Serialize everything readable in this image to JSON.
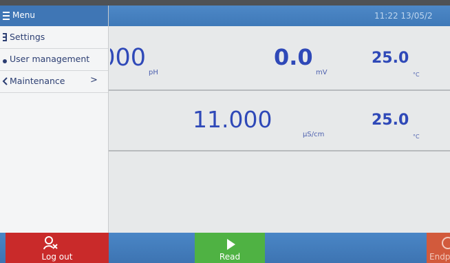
{
  "header": {
    "time": "11:22  13/05/2"
  },
  "menu": {
    "title": "Menu",
    "items": [
      {
        "label": "Settings",
        "icon": "gear-icon"
      },
      {
        "label": "User management",
        "icon": "user-icon"
      },
      {
        "label": "Maintenance",
        "icon": "wrench-icon",
        "chevron": ">"
      }
    ]
  },
  "measurements": {
    "row1": {
      "ph_value": "000",
      "ph_unit": "pH",
      "mv_value": "0.0",
      "mv_unit": "mV",
      "temp_value": "25.0",
      "temp_unit": "°C"
    },
    "row2": {
      "cond_value": "11.000",
      "cond_unit": "µS/cm",
      "temp_value": "25.0",
      "temp_unit": "°C"
    }
  },
  "footer": {
    "logout_label": "Log out",
    "read_label": "Read",
    "endpoint_label": "Endp"
  },
  "colors": {
    "accent_blue": "#3f76b5",
    "value_blue": "#2f49b8",
    "logout_red": "#c92a2a",
    "read_green": "#4fb243",
    "endpoint_orange": "#d25a3c"
  }
}
